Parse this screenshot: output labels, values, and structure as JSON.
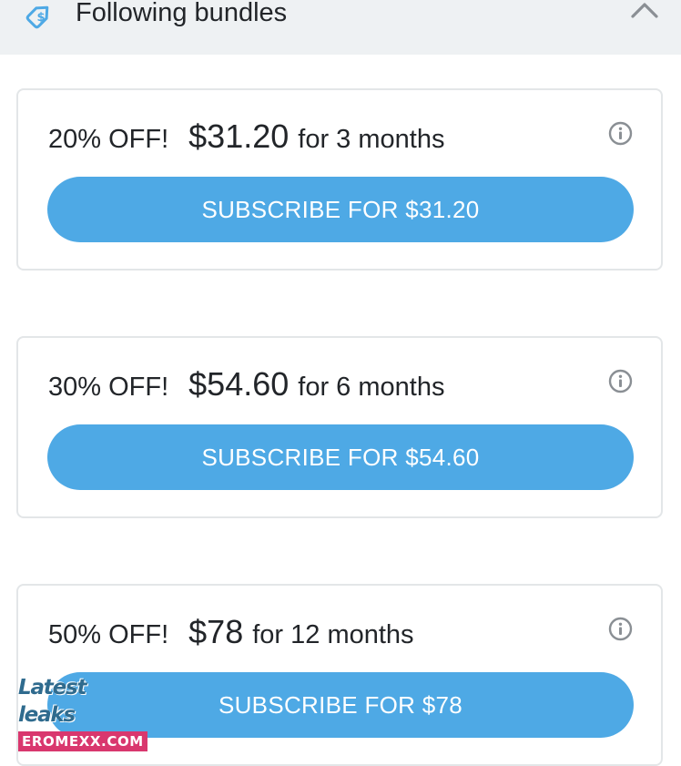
{
  "header": {
    "title": "Following bundles",
    "icon": "price-tag-icon",
    "collapse_icon": "chevron-up-icon"
  },
  "bundles": [
    {
      "discount": "20% OFF!",
      "price": "$31.20",
      "term": "for 3 months",
      "button_label": "SUBSCRIBE FOR $31.20"
    },
    {
      "discount": "30% OFF!",
      "price": "$54.60",
      "term": "for 6 months",
      "button_label": "SUBSCRIBE FOR $54.60"
    },
    {
      "discount": "50% OFF!",
      "price": "$78",
      "term": "for 12 months",
      "button_label": "SUBSCRIBE FOR $78"
    }
  ],
  "watermark": {
    "line1": "Latest leaks",
    "line2": "EROMEXX.COM"
  },
  "colors": {
    "accent": "#4ea9e5",
    "header_bg": "#eef1f3",
    "card_border": "#e3e6e8",
    "text": "#222529",
    "icon_gray": "#8a8f94"
  }
}
